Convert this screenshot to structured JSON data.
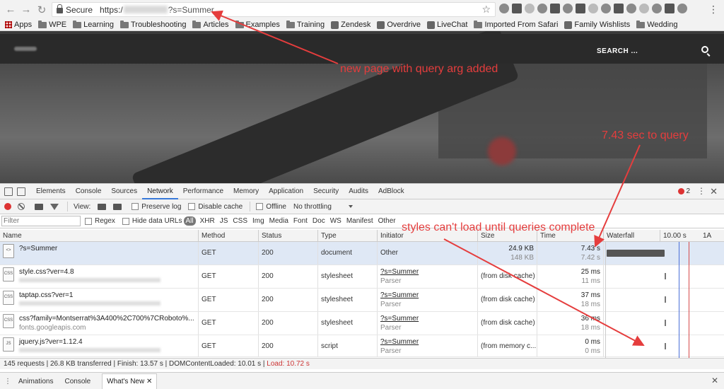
{
  "browser": {
    "secure_label": "Secure",
    "url_protocol": "https:/",
    "url_path": "?s=Summer",
    "bookmarks": [
      "Apps",
      "WPE",
      "Learning",
      "Troubleshooting",
      "Articles",
      "Examples",
      "Training",
      "Zendesk",
      "Overdrive",
      "LiveChat",
      "Imported From Safari",
      "Family Wishlists",
      "Wedding"
    ]
  },
  "site": {
    "search_label": "SEARCH ..."
  },
  "devtools": {
    "tabs": [
      "Elements",
      "Console",
      "Sources",
      "Network",
      "Performance",
      "Memory",
      "Application",
      "Security",
      "Audits",
      "AdBlock"
    ],
    "active_tab": "Network",
    "error_count": "2",
    "toolbar": {
      "view_label": "View:",
      "preserve_log": "Preserve log",
      "disable_cache": "Disable cache",
      "offline": "Offline",
      "throttling": "No throttling"
    },
    "filter": {
      "placeholder": "Filter",
      "regex": "Regex",
      "hide_data_urls": "Hide data URLs",
      "all": "All",
      "types": [
        "XHR",
        "JS",
        "CSS",
        "Img",
        "Media",
        "Font",
        "Doc",
        "WS",
        "Manifest",
        "Other"
      ]
    },
    "columns": [
      "Name",
      "Method",
      "Status",
      "Type",
      "Initiator",
      "Size",
      "Time",
      "Waterfall",
      "10.00 s",
      "1A"
    ],
    "requests": [
      {
        "icon": "<>",
        "name": "?s=Summer",
        "sub": "",
        "method": "GET",
        "status": "200",
        "type": "document",
        "initiator": "Other",
        "initiator_sub": "",
        "size": "24.9 KB",
        "size_sub": "148 KB",
        "time": "7.43 s",
        "time_sub": "7.42 s"
      },
      {
        "icon": "CSS",
        "name": "style.css?ver=4.8",
        "sub": "",
        "method": "GET",
        "status": "200",
        "type": "stylesheet",
        "initiator": "?s=Summer",
        "initiator_sub": "Parser",
        "size": "(from disk cache)",
        "size_sub": "",
        "time": "25 ms",
        "time_sub": "11 ms"
      },
      {
        "icon": "CSS",
        "name": "taptap.css?ver=1",
        "sub": "",
        "method": "GET",
        "status": "200",
        "type": "stylesheet",
        "initiator": "?s=Summer",
        "initiator_sub": "Parser",
        "size": "(from disk cache)",
        "size_sub": "",
        "time": "37 ms",
        "time_sub": "18 ms"
      },
      {
        "icon": "CSS",
        "name": "css?family=Montserrat%3A400%2C700%7CRoboto%...",
        "sub": "fonts.googleapis.com",
        "method": "GET",
        "status": "200",
        "type": "stylesheet",
        "initiator": "?s=Summer",
        "initiator_sub": "Parser",
        "size": "(from disk cache)",
        "size_sub": "",
        "time": "36 ms",
        "time_sub": "18 ms"
      },
      {
        "icon": "JS",
        "name": "jquery.js?ver=1.12.4",
        "sub": "",
        "method": "GET",
        "status": "200",
        "type": "script",
        "initiator": "?s=Summer",
        "initiator_sub": "Parser",
        "size": "(from memory c...",
        "size_sub": "",
        "time": "0 ms",
        "time_sub": "0 ms"
      }
    ],
    "status_bar": {
      "summary": "145 requests | 26.8 KB transferred | Finish: 13.57 s | DOMContentLoaded: 10.01 s | ",
      "load": "Load: 10.72 s"
    },
    "drawer_tabs": [
      "Animations",
      "Console",
      "What's New"
    ]
  },
  "annotations": {
    "query_arg": "new page with query arg added",
    "query_time": "7.43 sec to query",
    "styles_wait": "styles can't load until queries complete"
  },
  "colors": {
    "annotation": "#e53d3d",
    "record": "#d33",
    "selected_row": "#dfe8f5"
  }
}
